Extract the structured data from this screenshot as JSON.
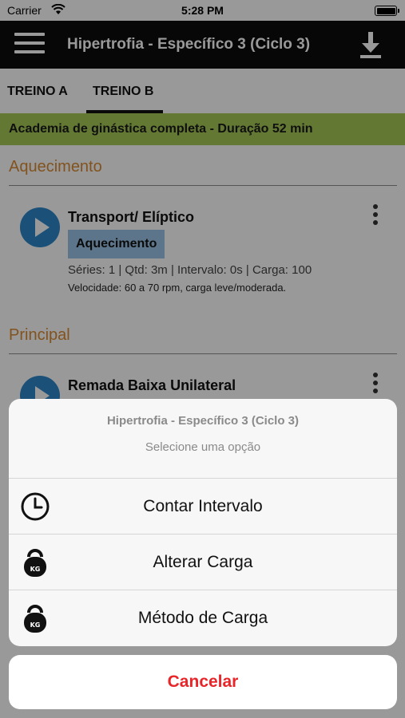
{
  "status_bar": {
    "carrier": "Carrier",
    "time": "5:28 PM"
  },
  "nav": {
    "title": "Hipertrofia - Específico 3 (Ciclo 3)",
    "menu_icon": "hamburger-menu-icon",
    "download_icon": "download-icon"
  },
  "tabs": {
    "items": [
      {
        "label": "TREINO A",
        "active": false
      },
      {
        "label": "TREINO B",
        "active": true
      }
    ]
  },
  "banner": {
    "text": "Academia de ginástica completa - Duração 52 min",
    "color": "#a6c856"
  },
  "sections": [
    {
      "title": "Aquecimento",
      "exercise": {
        "name": "Transport/ Elíptico",
        "tag": "Aquecimento",
        "meta": "Séries: 1 | Qtd: 3m | Intervalo: 0s | Carga: 100",
        "note": "Velocidade: 60 a 70 rpm, carga leve/moderada."
      }
    },
    {
      "title": "Principal",
      "exercise": {
        "name": "Remada Baixa Unilateral"
      }
    }
  ],
  "action_sheet": {
    "title": "Hipertrofia - Específico 3 (Ciclo 3)",
    "subtitle": "Selecione uma opção",
    "options": [
      {
        "label": "Contar Intervalo",
        "icon": "clock-icon"
      },
      {
        "label": "Alterar Carga",
        "icon": "kettlebell-kg-icon",
        "icon_text": "KG"
      },
      {
        "label": "Método de Carga",
        "icon": "kettlebell-kg-icon",
        "icon_text": "KG"
      }
    ],
    "cancel_label": "Cancelar"
  },
  "colors": {
    "accent_section": "#d98a32",
    "play_button": "#2e86c9",
    "cancel": "#e8262a",
    "navbar": "#0d0d0d"
  }
}
